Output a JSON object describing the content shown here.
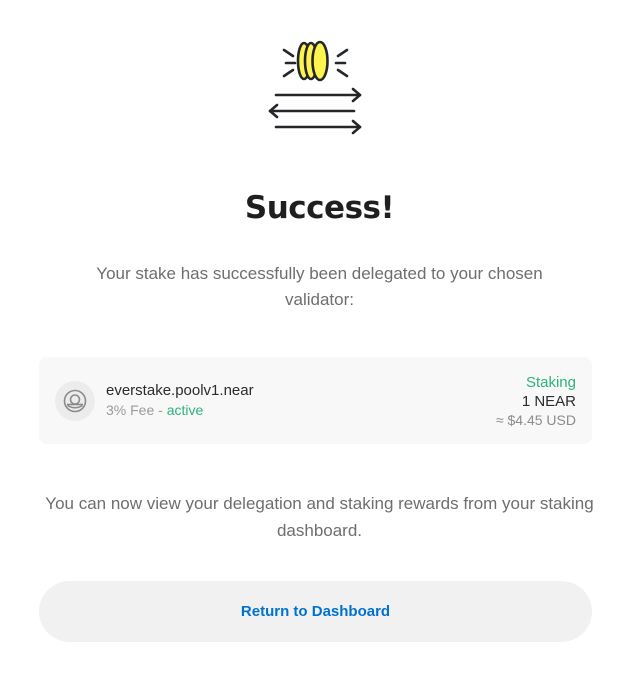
{
  "header": {
    "icon": "coins-transfer-icon",
    "title": "Success!",
    "message": "Your stake has successfully been delegated to your chosen validator:"
  },
  "validator": {
    "icon": "validator-avatar-icon",
    "name": "everstake.poolv1.near",
    "fee": "3% Fee",
    "separator": " - ",
    "status": "active",
    "staking_label": "Staking",
    "amount": "1 NEAR",
    "usd": "≈ $4.45 USD"
  },
  "footer": {
    "message": "You can now view your delegation and staking rewards from your staking dashboard.",
    "button_label": "Return to Dashboard"
  },
  "colors": {
    "accent_green": "#2db37c",
    "link_blue": "#0072ce",
    "coin_yellow": "#fff44f"
  }
}
